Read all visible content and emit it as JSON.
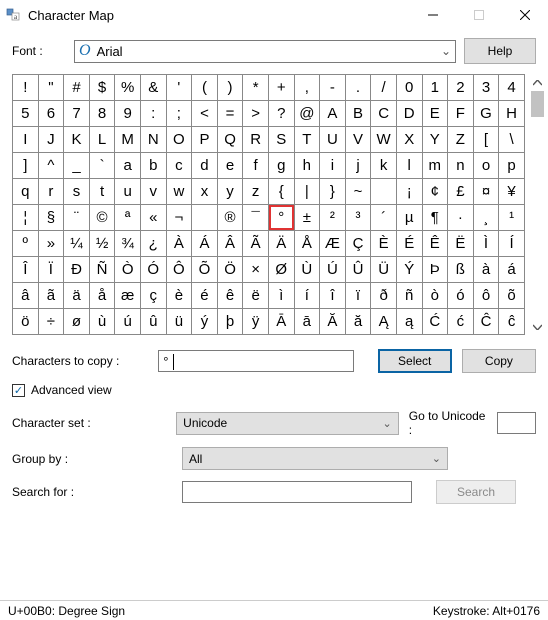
{
  "window": {
    "title": "Character Map"
  },
  "font": {
    "label": "Font :",
    "name": "Arial",
    "help_label": "Help"
  },
  "chars": [
    "!",
    "\"",
    "#",
    "$",
    "%",
    "&",
    "'",
    "(",
    ")",
    "*",
    "+",
    ",",
    "-",
    ".",
    "/",
    "0",
    "1",
    "2",
    "3",
    "4",
    "5",
    "6",
    "7",
    "8",
    "9",
    ":",
    ";",
    "<",
    "=",
    ">",
    "?",
    "@",
    "A",
    "B",
    "C",
    "D",
    "E",
    "F",
    "G",
    "H",
    "I",
    "J",
    "K",
    "L",
    "M",
    "N",
    "O",
    "P",
    "Q",
    "R",
    "S",
    "T",
    "U",
    "V",
    "W",
    "X",
    "Y",
    "Z",
    "[",
    "\\",
    "]",
    "^",
    "_",
    "`",
    "a",
    "b",
    "c",
    "d",
    "e",
    "f",
    "g",
    "h",
    "i",
    "j",
    "k",
    "l",
    "m",
    "n",
    "o",
    "p",
    "q",
    "r",
    "s",
    "t",
    "u",
    "v",
    "w",
    "x",
    "y",
    "z",
    "{",
    "|",
    "}",
    "~",
    "",
    "¡",
    "¢",
    "£",
    "¤",
    "¥",
    "¦",
    "§",
    "¨",
    "©",
    "ª",
    "«",
    "¬",
    "­",
    "®",
    "¯",
    "°",
    "±",
    "²",
    "³",
    "´",
    "µ",
    "¶",
    "·",
    "¸",
    "¹",
    "º",
    "»",
    "¼",
    "½",
    "¾",
    "¿",
    "À",
    "Á",
    "Â",
    "Ã",
    "Ä",
    "Å",
    "Æ",
    "Ç",
    "È",
    "É",
    "Ê",
    "Ë",
    "Ì",
    "Í",
    "Î",
    "Ï",
    "Ð",
    "Ñ",
    "Ò",
    "Ó",
    "Ô",
    "Õ",
    "Ö",
    "×",
    "Ø",
    "Ù",
    "Ú",
    "Û",
    "Ü",
    "Ý",
    "Þ",
    "ß",
    "à",
    "á",
    "â",
    "ã",
    "ä",
    "å",
    "æ",
    "ç",
    "è",
    "é",
    "ê",
    "ë",
    "ì",
    "í",
    "î",
    "ï",
    "ð",
    "ñ",
    "ò",
    "ó",
    "ô",
    "õ",
    "ö",
    "÷",
    "ø",
    "ù",
    "ú",
    "û",
    "ü",
    "ý",
    "þ",
    "ÿ",
    "Ā",
    "ā",
    "Ă",
    "ă",
    "Ą",
    "ą",
    "Ć",
    "ć",
    "Ĉ",
    "ĉ"
  ],
  "selected_index": 110,
  "copy": {
    "label": "Characters to copy :",
    "value": "°",
    "select_label": "Select",
    "copy_label": "Copy"
  },
  "advanced": {
    "label": "Advanced view",
    "checked": true,
    "charset_label": "Character set :",
    "charset_value": "Unicode",
    "goto_label": "Go to Unicode :",
    "goto_value": "",
    "groupby_label": "Group by :",
    "groupby_value": "All",
    "search_label": "Search for :",
    "search_value": "",
    "search_btn": "Search"
  },
  "status": {
    "left": "U+00B0: Degree Sign",
    "right": "Keystroke: Alt+0176"
  }
}
